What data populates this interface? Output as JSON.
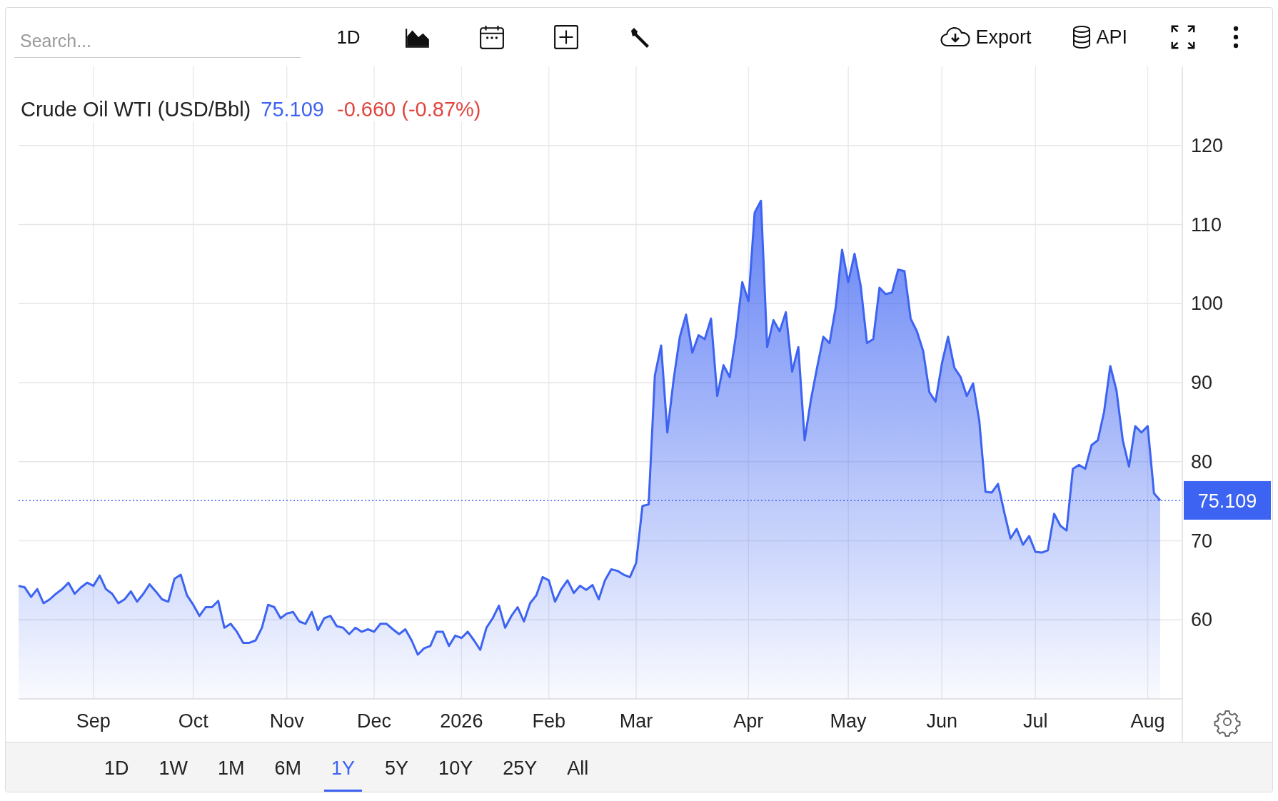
{
  "search": {
    "placeholder": "Search..."
  },
  "toolbar": {
    "interval": "1D",
    "actions": [
      {
        "label": "Export",
        "kind": "export"
      },
      {
        "label": "API",
        "kind": "api"
      }
    ]
  },
  "quote": {
    "price": "75.109",
    "change": {
      "text": "-0.660 (-0.87%)",
      "color": "#e0473f"
    }
  },
  "chart": {
    "chart_data": {
      "type": "area",
      "title": "Crude Oil WTI (USD/Bbl)",
      "categories": [
        null,
        null,
        null,
        null,
        null,
        null,
        null,
        null,
        null,
        null,
        null,
        null,
        "Sep",
        null,
        null,
        null,
        null,
        null,
        null,
        null,
        null,
        null,
        null,
        null,
        null,
        null,
        null,
        null,
        "Oct",
        null,
        null,
        null,
        null,
        null,
        null,
        null,
        null,
        null,
        null,
        null,
        null,
        null,
        null,
        "Nov",
        null,
        null,
        null,
        null,
        null,
        null,
        null,
        null,
        null,
        null,
        null,
        null,
        null,
        "Dec",
        null,
        null,
        null,
        null,
        null,
        null,
        null,
        null,
        null,
        null,
        null,
        null,
        null,
        "2026",
        null,
        null,
        null,
        null,
        null,
        null,
        null,
        null,
        null,
        null,
        null,
        null,
        null,
        "Feb",
        null,
        null,
        null,
        null,
        null,
        null,
        null,
        null,
        null,
        null,
        null,
        null,
        null,
        "Mar",
        null,
        null,
        null,
        null,
        null,
        null,
        null,
        null,
        null,
        null,
        null,
        null,
        null,
        null,
        null,
        null,
        null,
        "Apr",
        null,
        null,
        null,
        null,
        null,
        null,
        null,
        null,
        null,
        null,
        null,
        null,
        null,
        null,
        null,
        "May",
        null,
        null,
        null,
        null,
        null,
        null,
        null,
        null,
        null,
        null,
        null,
        null,
        null,
        null,
        "Jun",
        null,
        null,
        null,
        null,
        null,
        null,
        null,
        null,
        null,
        null,
        null,
        null,
        null,
        null,
        "Jul",
        null,
        null,
        null,
        null,
        null,
        null,
        null,
        null,
        null,
        null,
        null,
        null,
        null,
        null,
        null,
        null,
        null,
        "Aug",
        null,
        null
      ],
      "series": [
        {
          "color": "#3d63f2",
          "values": [
            64.3,
            64.1,
            62.9,
            63.9,
            62.1,
            62.6,
            63.3,
            63.9,
            64.7,
            63.3,
            64.1,
            64.7,
            64.3,
            65.6,
            63.9,
            63.3,
            62.1,
            62.6,
            63.6,
            62.3,
            63.3,
            64.5,
            63.6,
            62.6,
            62.3,
            65.2,
            65.7,
            63.1,
            61.9,
            60.5,
            61.6,
            61.6,
            62.4,
            59.0,
            59.5,
            58.5,
            57.1,
            57.1,
            57.4,
            59.0,
            61.9,
            61.6,
            60.2,
            60.8,
            61.0,
            59.8,
            59.5,
            61.0,
            58.7,
            60.2,
            60.5,
            59.2,
            59.0,
            58.2,
            59.0,
            58.5,
            58.8,
            58.5,
            59.5,
            59.5,
            58.8,
            58.2,
            58.8,
            57.4,
            55.6,
            56.4,
            56.7,
            58.5,
            58.5,
            56.7,
            58.0,
            57.7,
            58.5,
            57.4,
            56.2,
            59.0,
            60.2,
            61.8,
            59.0,
            60.5,
            61.6,
            59.8,
            62.1,
            63.1,
            65.4,
            65.0,
            62.3,
            63.9,
            65.0,
            63.4,
            64.3,
            63.8,
            64.4,
            62.6,
            65.0,
            66.4,
            66.2,
            65.7,
            65.4,
            67.2,
            74.4,
            74.6,
            90.9,
            94.7,
            83.7,
            90.4,
            95.8,
            98.6,
            93.8,
            96.0,
            95.5,
            98.1,
            88.3,
            92.2,
            90.7,
            96.0,
            102.7,
            100.3,
            111.5,
            113.0,
            94.5,
            97.9,
            96.5,
            98.9,
            91.4,
            94.5,
            82.7,
            87.8,
            91.9,
            95.8,
            95.0,
            99.6,
            106.8,
            102.7,
            106.3,
            102.2,
            95.0,
            95.5,
            102.0,
            101.2,
            101.4,
            104.3,
            104.1,
            98.1,
            96.5,
            94.0,
            88.8,
            87.6,
            92.4,
            95.8,
            91.9,
            90.7,
            88.3,
            89.9,
            85.2,
            76.2,
            76.1,
            77.2,
            73.6,
            70.3,
            71.5,
            69.5,
            70.6,
            68.6,
            68.5,
            68.8,
            73.4,
            71.9,
            71.3,
            79.1,
            79.6,
            79.1,
            82.1,
            82.7,
            86.3,
            92.1,
            89.0,
            82.7,
            79.4,
            84.5,
            83.7,
            84.5,
            76.0,
            75.1
          ]
        }
      ],
      "ylim": [
        50,
        130
      ],
      "yticks": [
        60,
        70,
        80,
        90,
        100,
        110,
        120
      ],
      "grid": true,
      "ref_lines": [
        {
          "axis": "y",
          "value": 75.109
        }
      ],
      "annotations": [
        "75.109"
      ]
    }
  },
  "ranges": [
    {
      "label": "1D",
      "selected": false
    },
    {
      "label": "1W",
      "selected": false
    },
    {
      "label": "1M",
      "selected": false
    },
    {
      "label": "6M",
      "selected": false
    },
    {
      "label": "1Y",
      "selected": true
    },
    {
      "label": "5Y",
      "selected": false
    },
    {
      "label": "10Y",
      "selected": false
    },
    {
      "label": "25Y",
      "selected": false
    },
    {
      "label": "All",
      "selected": false
    }
  ]
}
